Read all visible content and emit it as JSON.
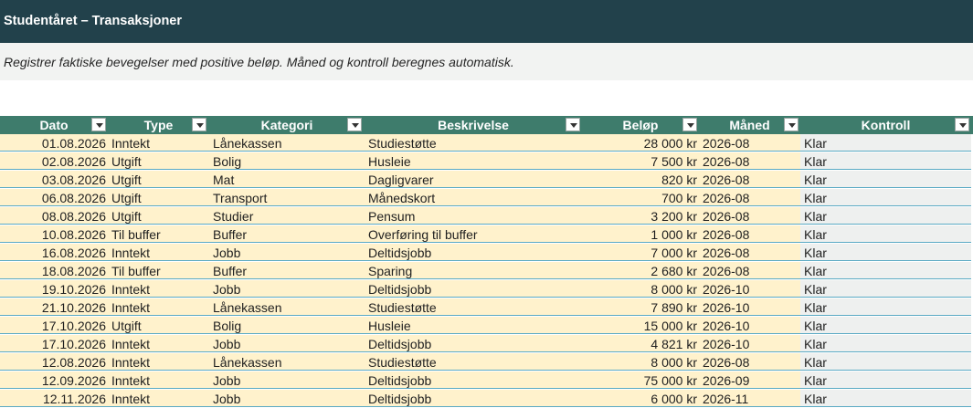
{
  "sheet": {
    "title": "Studentåret – Transaksjoner",
    "subtitle": "Registrer faktiske bevegelser med positive beløp. Måned og kontroll beregnes automatisk."
  },
  "table": {
    "columns": [
      "Dato",
      "Type",
      "Kategori",
      "Beskrivelse",
      "Beløp",
      "Måned",
      "Kontroll"
    ],
    "rows": [
      [
        "01.08.2026",
        "Inntekt",
        "Lånekassen",
        "Studiestøtte",
        "28 000 kr",
        "2026-08",
        "Klar"
      ],
      [
        "02.08.2026",
        "Utgift",
        "Bolig",
        "Husleie",
        "7 500 kr",
        "2026-08",
        "Klar"
      ],
      [
        "03.08.2026",
        "Utgift",
        "Mat",
        "Dagligvarer",
        "820 kr",
        "2026-08",
        "Klar"
      ],
      [
        "06.08.2026",
        "Utgift",
        "Transport",
        "Månedskort",
        "700 kr",
        "2026-08",
        "Klar"
      ],
      [
        "08.08.2026",
        "Utgift",
        "Studier",
        "Pensum",
        "3 200 kr",
        "2026-08",
        "Klar"
      ],
      [
        "10.08.2026",
        "Til buffer",
        "Buffer",
        "Overføring til buffer",
        "1 000 kr",
        "2026-08",
        "Klar"
      ],
      [
        "16.08.2026",
        "Inntekt",
        "Jobb",
        "Deltidsjobb",
        "7 000 kr",
        "2026-08",
        "Klar"
      ],
      [
        "18.08.2026",
        "Til buffer",
        "Buffer",
        "Sparing",
        "2 680 kr",
        "2026-08",
        "Klar"
      ],
      [
        "19.10.2026",
        "Inntekt",
        "Jobb",
        "Deltidsjobb",
        "8 000 kr",
        "2026-10",
        "Klar"
      ],
      [
        "21.10.2026",
        "Inntekt",
        "Lånekassen",
        "Studiestøtte",
        "7 890 kr",
        "2026-10",
        "Klar"
      ],
      [
        "17.10.2026",
        "Utgift",
        "Bolig",
        "Husleie",
        "15 000 kr",
        "2026-10",
        "Klar"
      ],
      [
        "17.10.2026",
        "Inntekt",
        "Jobb",
        "Deltidsjobb",
        "4 821 kr",
        "2026-10",
        "Klar"
      ],
      [
        "12.08.2026",
        "Inntekt",
        "Lånekassen",
        "Studiestøtte",
        "8 000 kr",
        "2026-08",
        "Klar"
      ],
      [
        "12.09.2026",
        "Inntekt",
        "Jobb",
        "Deltidsjobb",
        "75 000 kr",
        "2026-09",
        "Klar"
      ],
      [
        "12.11.2026",
        "Inntekt",
        "Jobb",
        "Deltidsjobb",
        "6 000 kr",
        "2026-11",
        "Klar"
      ]
    ]
  },
  "colors": {
    "title_bg": "#22414b",
    "header_bg": "#3e7c6c",
    "input_cells": "#fff2cc",
    "calculated_cells": "#eef0ef"
  },
  "icons": {
    "filter": "filter-dropdown-icon"
  }
}
